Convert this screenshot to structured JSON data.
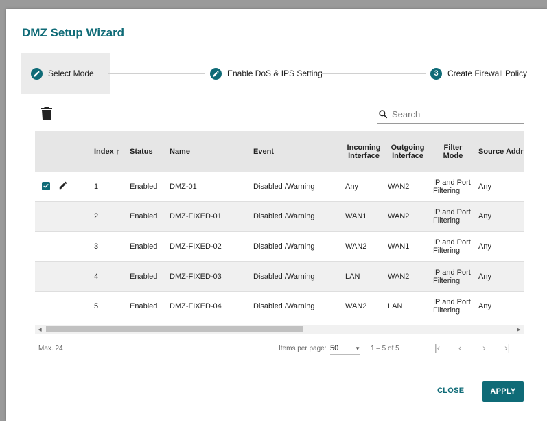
{
  "dialog": {
    "title": "DMZ Setup Wizard"
  },
  "stepper": {
    "steps": [
      {
        "label": "Select Mode",
        "state": "done"
      },
      {
        "label": "Enable DoS & IPS Setting",
        "state": "done"
      },
      {
        "label": "Create Firewall Policy",
        "state": "active",
        "number": "3"
      }
    ]
  },
  "toolbar": {
    "search_placeholder": "Search"
  },
  "table": {
    "headers": {
      "index": "Index",
      "status": "Status",
      "name": "Name",
      "event": "Event",
      "incoming": "Incoming Interface",
      "outgoing": "Outgoing Interface",
      "filter": "Filter Mode",
      "source": "Source Address"
    },
    "rows": [
      {
        "index": "1",
        "status": "Enabled",
        "name": "DMZ-01",
        "event": "Disabled /Warning",
        "incoming": "Any",
        "outgoing": "WAN2",
        "filter": "IP and Port Filtering",
        "source": "Any",
        "selected": true
      },
      {
        "index": "2",
        "status": "Enabled",
        "name": "DMZ-FIXED-01",
        "event": "Disabled /Warning",
        "incoming": "WAN1",
        "outgoing": "WAN2",
        "filter": "IP and Port Filtering",
        "source": "Any",
        "selected": false
      },
      {
        "index": "3",
        "status": "Enabled",
        "name": "DMZ-FIXED-02",
        "event": "Disabled /Warning",
        "incoming": "WAN2",
        "outgoing": "WAN1",
        "filter": "IP and Port Filtering",
        "source": "Any",
        "selected": false
      },
      {
        "index": "4",
        "status": "Enabled",
        "name": "DMZ-FIXED-03",
        "event": "Disabled /Warning",
        "incoming": "LAN",
        "outgoing": "WAN2",
        "filter": "IP and Port Filtering",
        "source": "Any",
        "selected": false
      },
      {
        "index": "5",
        "status": "Enabled",
        "name": "DMZ-FIXED-04",
        "event": "Disabled /Warning",
        "incoming": "WAN2",
        "outgoing": "LAN",
        "filter": "IP and Port Filtering",
        "source": "Any",
        "selected": false
      }
    ]
  },
  "footer": {
    "max_text": "Max. 24",
    "items_per_page_label": "Items per page:",
    "items_per_page_value": "50",
    "range_text": "1 – 5 of 5"
  },
  "actions": {
    "close_label": "CLOSE",
    "apply_label": "APPLY"
  },
  "colors": {
    "accent": "#0f6b77"
  }
}
